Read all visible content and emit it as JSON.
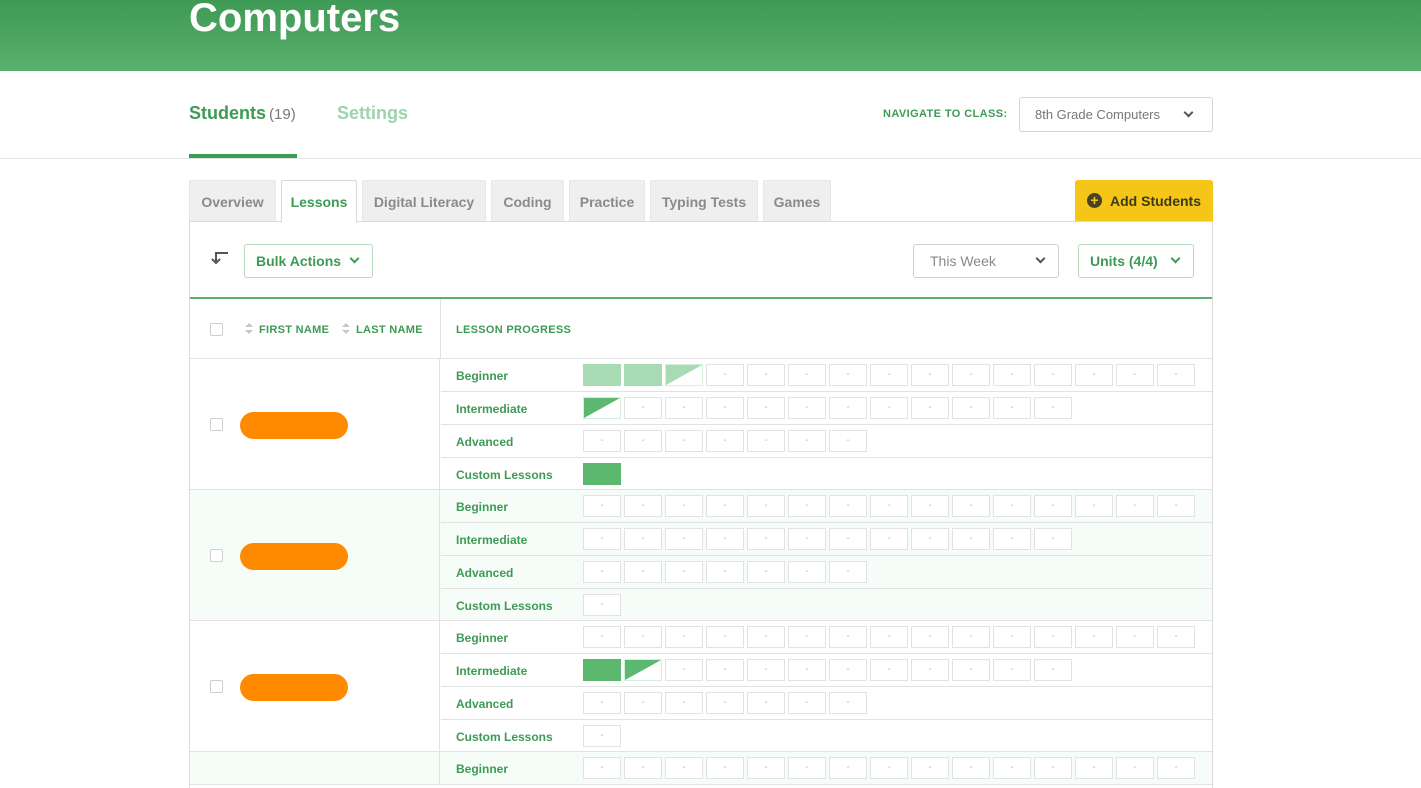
{
  "hero": {
    "title": "Computers"
  },
  "subnav": {
    "students_label": "Students",
    "students_count": "(19)",
    "settings_label": "Settings",
    "navigate_label": "NAVIGATE TO CLASS:",
    "class_select_value": "8th Grade Computers"
  },
  "tabs": [
    "Overview",
    "Lessons",
    "Digital Literacy",
    "Coding",
    "Practice",
    "Typing Tests",
    "Games"
  ],
  "active_tab": "Lessons",
  "add_students_label": "Add Students",
  "toolbar": {
    "bulk_actions": "Bulk Actions",
    "period": "This Week",
    "units": "Units (4/4)"
  },
  "table_headers": {
    "first_name": "FIRST NAME",
    "last_name": "LAST NAME",
    "lesson_progress": "LESSON PROGRESS"
  },
  "empty_cell": "-",
  "colors": {
    "brand_green": "#3e9a55",
    "complete": "#5bb86e",
    "complete_light": "#a8dab3",
    "accent_yellow": "#f5c518",
    "redaction": "#ff8a00"
  },
  "students": [
    {
      "levels": [
        {
          "name": "Beginner",
          "cells": [
            "full-light",
            "full-light",
            "partial-light",
            "-",
            "-",
            "-",
            "-",
            "-",
            "-",
            "-",
            "-",
            "-",
            "-",
            "-",
            "-"
          ]
        },
        {
          "name": "Intermediate",
          "cells": [
            "partial",
            "-",
            "-",
            "-",
            "-",
            "-",
            "-",
            "-",
            "-",
            "-",
            "-",
            "-"
          ]
        },
        {
          "name": "Advanced",
          "cells": [
            "-",
            "-",
            "-",
            "-",
            "-",
            "-",
            "-"
          ]
        },
        {
          "name": "Custom Lessons",
          "cells": [
            "full"
          ]
        }
      ]
    },
    {
      "levels": [
        {
          "name": "Beginner",
          "cells": [
            "-",
            "-",
            "-",
            "-",
            "-",
            "-",
            "-",
            "-",
            "-",
            "-",
            "-",
            "-",
            "-",
            "-",
            "-"
          ]
        },
        {
          "name": "Intermediate",
          "cells": [
            "-",
            "-",
            "-",
            "-",
            "-",
            "-",
            "-",
            "-",
            "-",
            "-",
            "-",
            "-"
          ]
        },
        {
          "name": "Advanced",
          "cells": [
            "-",
            "-",
            "-",
            "-",
            "-",
            "-",
            "-"
          ]
        },
        {
          "name": "Custom Lessons",
          "cells": [
            "-"
          ]
        }
      ]
    },
    {
      "levels": [
        {
          "name": "Beginner",
          "cells": [
            "-",
            "-",
            "-",
            "-",
            "-",
            "-",
            "-",
            "-",
            "-",
            "-",
            "-",
            "-",
            "-",
            "-",
            "-"
          ]
        },
        {
          "name": "Intermediate",
          "cells": [
            "full",
            "partial",
            "-",
            "-",
            "-",
            "-",
            "-",
            "-",
            "-",
            "-",
            "-",
            "-"
          ]
        },
        {
          "name": "Advanced",
          "cells": [
            "-",
            "-",
            "-",
            "-",
            "-",
            "-",
            "-"
          ]
        },
        {
          "name": "Custom Lessons",
          "cells": [
            "-"
          ]
        }
      ]
    },
    {
      "levels": [
        {
          "name": "Beginner",
          "cells": [
            "-",
            "-",
            "-",
            "-",
            "-",
            "-",
            "-",
            "-",
            "-",
            "-",
            "-",
            "-",
            "-",
            "-",
            "-"
          ]
        }
      ]
    }
  ]
}
